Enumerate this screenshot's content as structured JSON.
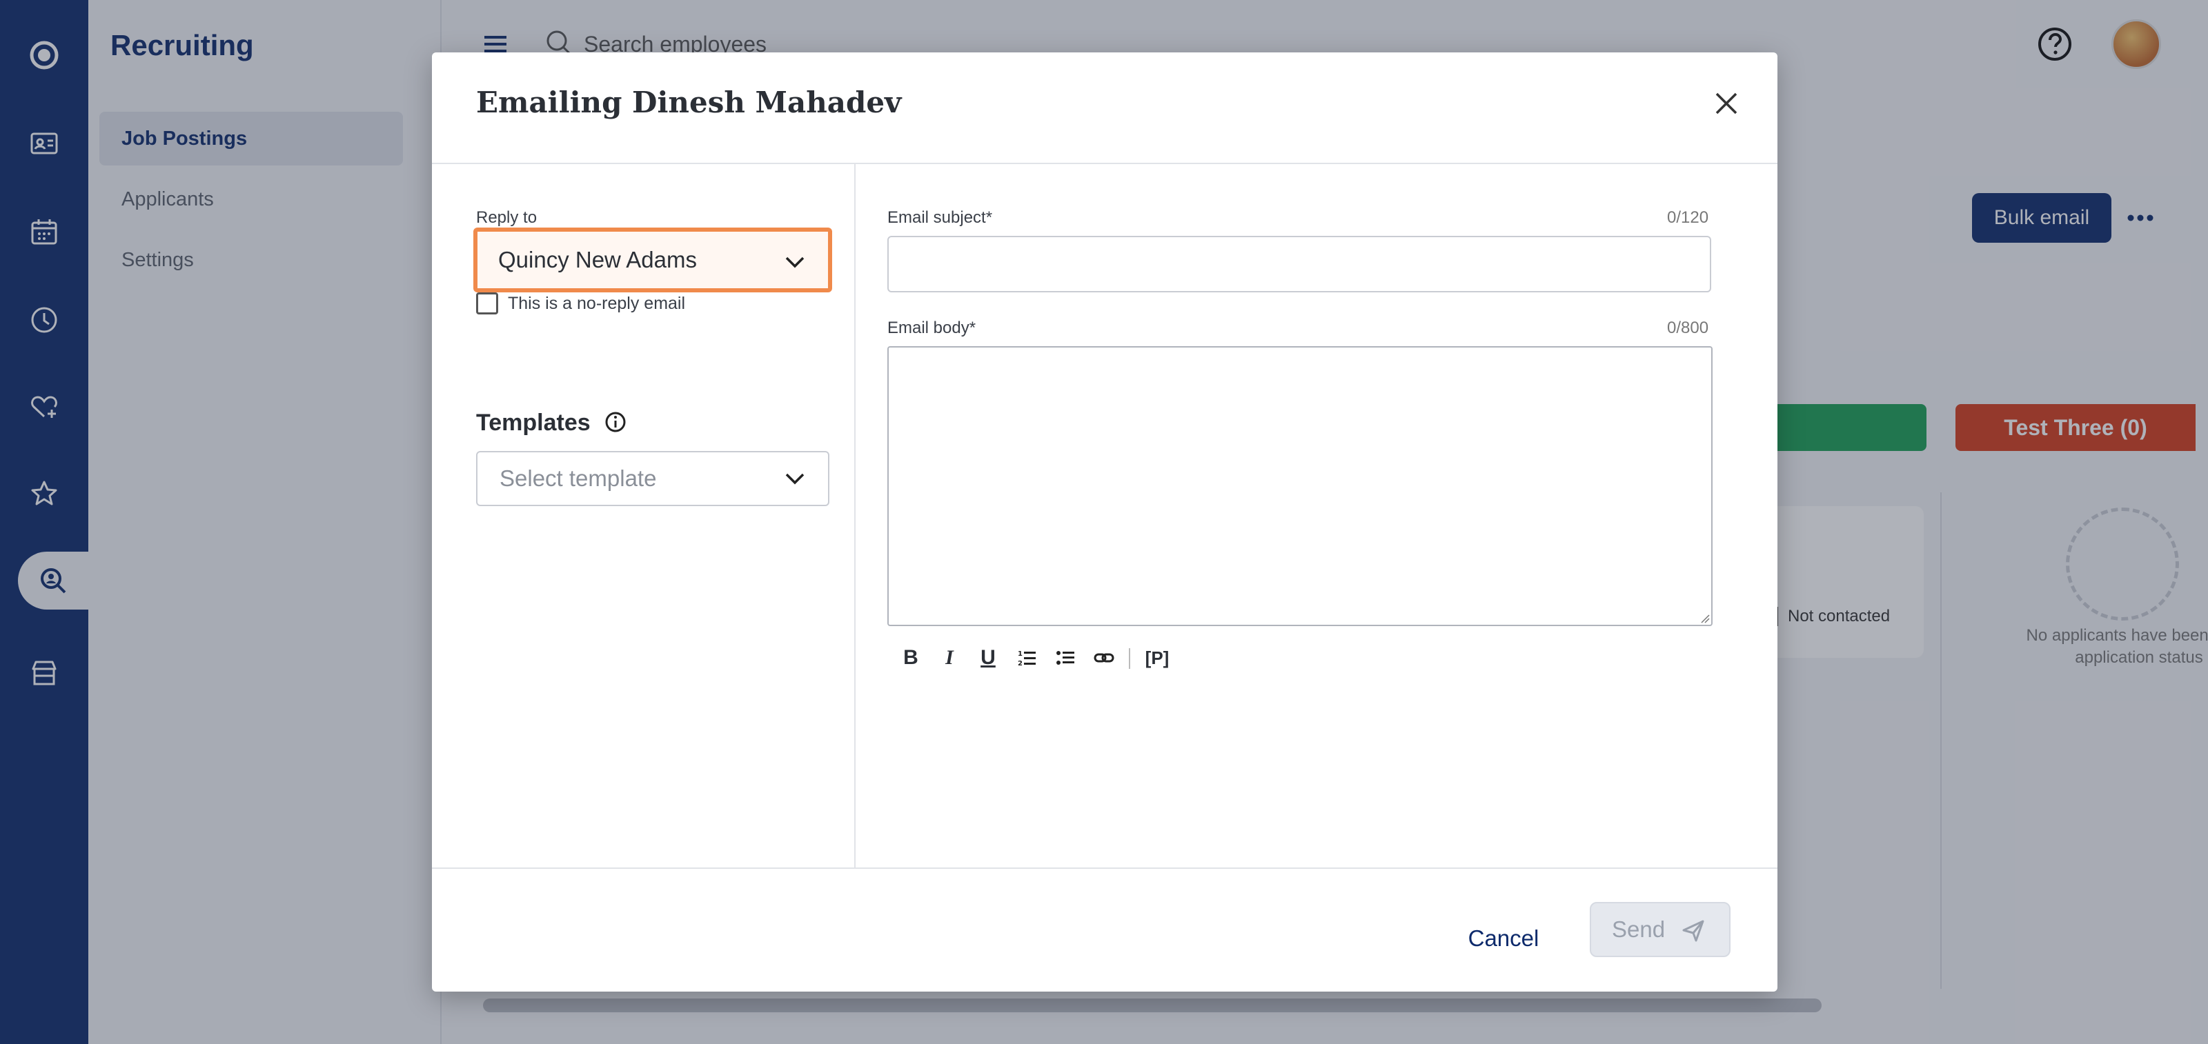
{
  "sidebar": {
    "title": "Recruiting",
    "items": [
      {
        "label": "Job Postings"
      },
      {
        "label": "Applicants"
      },
      {
        "label": "Settings"
      }
    ]
  },
  "topbar": {
    "search_placeholder": "Search employees"
  },
  "background": {
    "bulk_email_label": "Bulk email",
    "stage_red_label": "Test Three (0)",
    "card_status": "Not contacted",
    "empty_text": "No applicants have been assig\napplication status"
  },
  "modal": {
    "title": "Emailing Dinesh Mahadev",
    "reply_to_label": "Reply to",
    "reply_to_value": "Quincy New Adams",
    "no_reply_label": "This is a no-reply email",
    "templates_title": "Templates",
    "template_placeholder": "Select template",
    "subject_label": "Email subject*",
    "subject_count": "0/120",
    "body_label": "Email body*",
    "body_count": "0/800",
    "toolbar": {
      "bold": "B",
      "italic": "I",
      "underline": "U",
      "placeholder": "[P]"
    },
    "cancel_label": "Cancel",
    "send_label": "Send"
  },
  "colors": {
    "brand": "#0d2a6b",
    "focus_outline": "#f08a4b",
    "stage_green": "#1a9e55",
    "stage_red": "#d33d1c"
  }
}
